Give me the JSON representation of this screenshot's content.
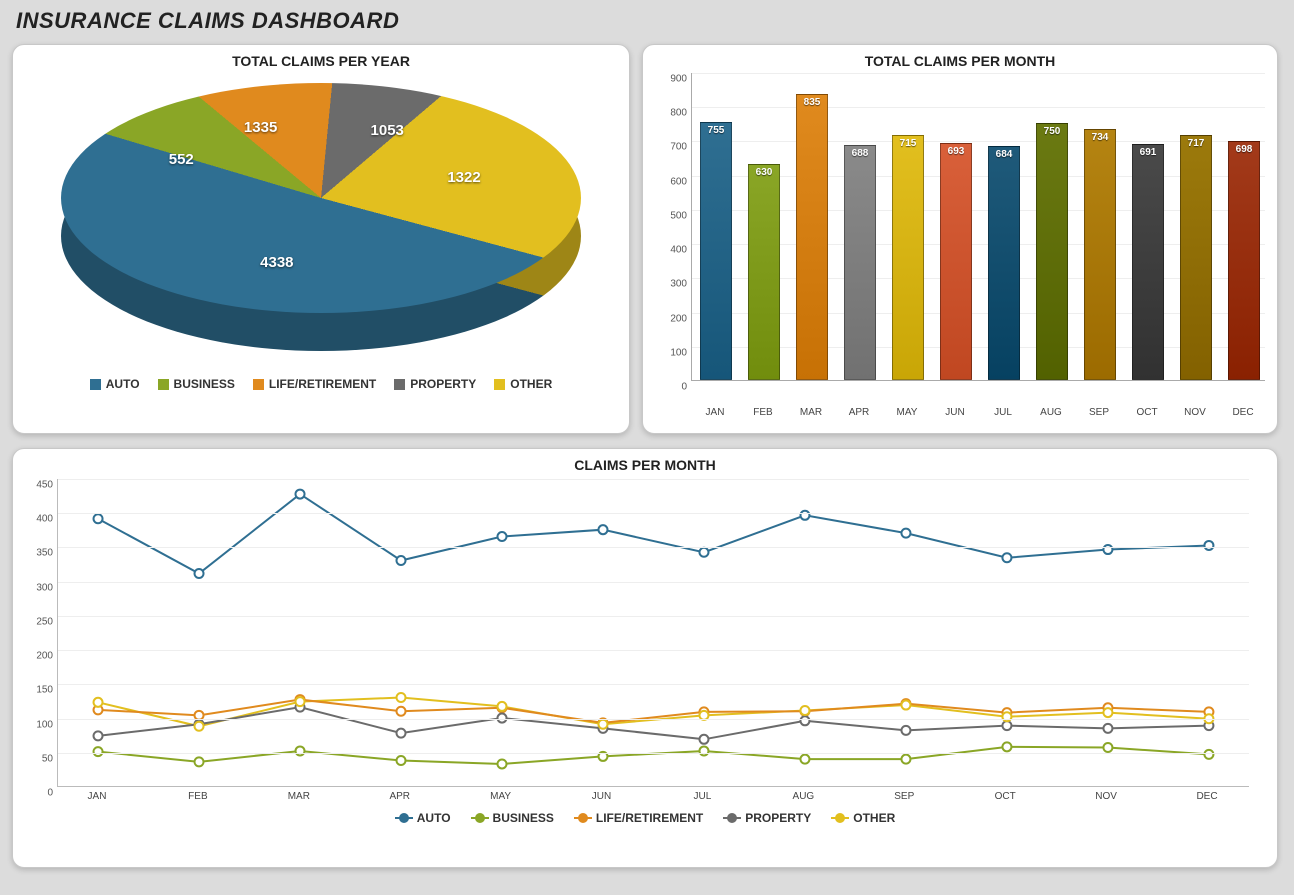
{
  "title": "INSURANCE CLAIMS DASHBOARD",
  "colors": {
    "auto": "#2f6f92",
    "business": "#8aa626",
    "life": "#e08a1e",
    "property": "#6b6b6b",
    "other": "#e2bf1f"
  },
  "bar_palette": [
    "#2f6f92",
    "#8aa626",
    "#e08a1e",
    "#8a8a8a",
    "#e2bf1f",
    "#d9603a",
    "#1f5a7a",
    "#6b7a12",
    "#b58412",
    "#4a4a4a",
    "#9c7a0c",
    "#a33a1a"
  ],
  "months": [
    "JAN",
    "FEB",
    "MAR",
    "APR",
    "MAY",
    "JUN",
    "JUL",
    "AUG",
    "SEP",
    "OCT",
    "NOV",
    "DEC"
  ],
  "pie": {
    "title": "TOTAL CLAIMS PER YEAR",
    "legend": [
      "AUTO",
      "BUSINESS",
      "LIFE/RETIREMENT",
      "PROPERTY",
      "OTHER"
    ]
  },
  "bar": {
    "title": "TOTAL CLAIMS PER MONTH",
    "ymax": 900,
    "ystep": 100
  },
  "line": {
    "title": "CLAIMS PER MONTH",
    "ymax": 450,
    "ystep": 50,
    "legend": [
      "AUTO",
      "BUSINESS",
      "LIFE/RETIREMENT",
      "PROPERTY",
      "OTHER"
    ]
  },
  "chart_data": [
    {
      "id": "pie_total_claims_per_year",
      "type": "pie",
      "title": "TOTAL CLAIMS PER YEAR",
      "categories": [
        "AUTO",
        "BUSINESS",
        "LIFE/RETIREMENT",
        "PROPERTY",
        "OTHER"
      ],
      "values": [
        4338,
        552,
        1335,
        1053,
        1322
      ]
    },
    {
      "id": "bar_total_claims_per_month",
      "type": "bar",
      "title": "TOTAL CLAIMS PER MONTH",
      "categories": [
        "JAN",
        "FEB",
        "MAR",
        "APR",
        "MAY",
        "JUN",
        "JUL",
        "AUG",
        "SEP",
        "OCT",
        "NOV",
        "DEC"
      ],
      "values": [
        755,
        630,
        835,
        688,
        715,
        693,
        684,
        750,
        734,
        691,
        717,
        698
      ],
      "ylabel": "",
      "xlabel": "",
      "ylim": [
        0,
        900
      ]
    },
    {
      "id": "line_claims_per_month",
      "type": "line",
      "title": "CLAIMS PER MONTH",
      "categories": [
        "JAN",
        "FEB",
        "MAR",
        "APR",
        "MAY",
        "JUN",
        "JUL",
        "AUG",
        "SEP",
        "OCT",
        "NOV",
        "DEC"
      ],
      "series": [
        {
          "name": "AUTO",
          "values": [
            392,
            312,
            428,
            331,
            366,
            376,
            343,
            397,
            371,
            335,
            347,
            353
          ]
        },
        {
          "name": "BUSINESS",
          "values": [
            52,
            37,
            53,
            39,
            34,
            45,
            53,
            41,
            41,
            59,
            58,
            48
          ]
        },
        {
          "name": "LIFE/RETIREMENT",
          "values": [
            113,
            105,
            128,
            111,
            116,
            94,
            110,
            111,
            122,
            109,
            116,
            110
          ]
        },
        {
          "name": "PROPERTY",
          "values": [
            75,
            92,
            117,
            79,
            101,
            86,
            70,
            97,
            83,
            90,
            86,
            90
          ]
        },
        {
          "name": "OTHER",
          "values": [
            124,
            89,
            125,
            131,
            118,
            92,
            105,
            112,
            120,
            103,
            109,
            100
          ]
        }
      ],
      "ylabel": "",
      "xlabel": "",
      "ylim": [
        0,
        450
      ]
    }
  ]
}
